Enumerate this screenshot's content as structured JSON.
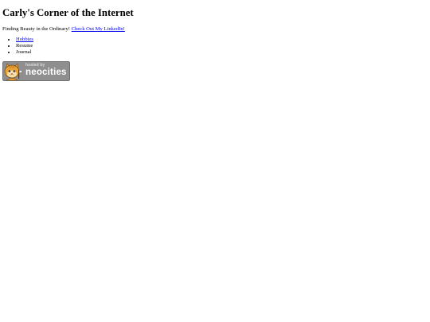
{
  "site": {
    "title": "Carly's Corner of the Internet",
    "tagline_text": "Finding Beauty in the Ordinary!",
    "linkedin_link": "Check Out My LinkedIn!"
  },
  "nav": {
    "items": [
      {
        "label": "Hobbies",
        "is_link": true
      },
      {
        "label": "Resume",
        "is_link": false
      },
      {
        "label": "Journal",
        "is_link": false
      }
    ]
  },
  "badge": {
    "small_text": "hosted by",
    "big_text": "neocities",
    "icon": "neocities-cat-icon",
    "colors": {
      "background": "#8f8f8f",
      "cat_orange": "#e8a33a",
      "cat_face": "#f6e2b3"
    }
  },
  "colors": {
    "link": "#0000ee",
    "text": "#000000",
    "background": "#ffffff"
  }
}
